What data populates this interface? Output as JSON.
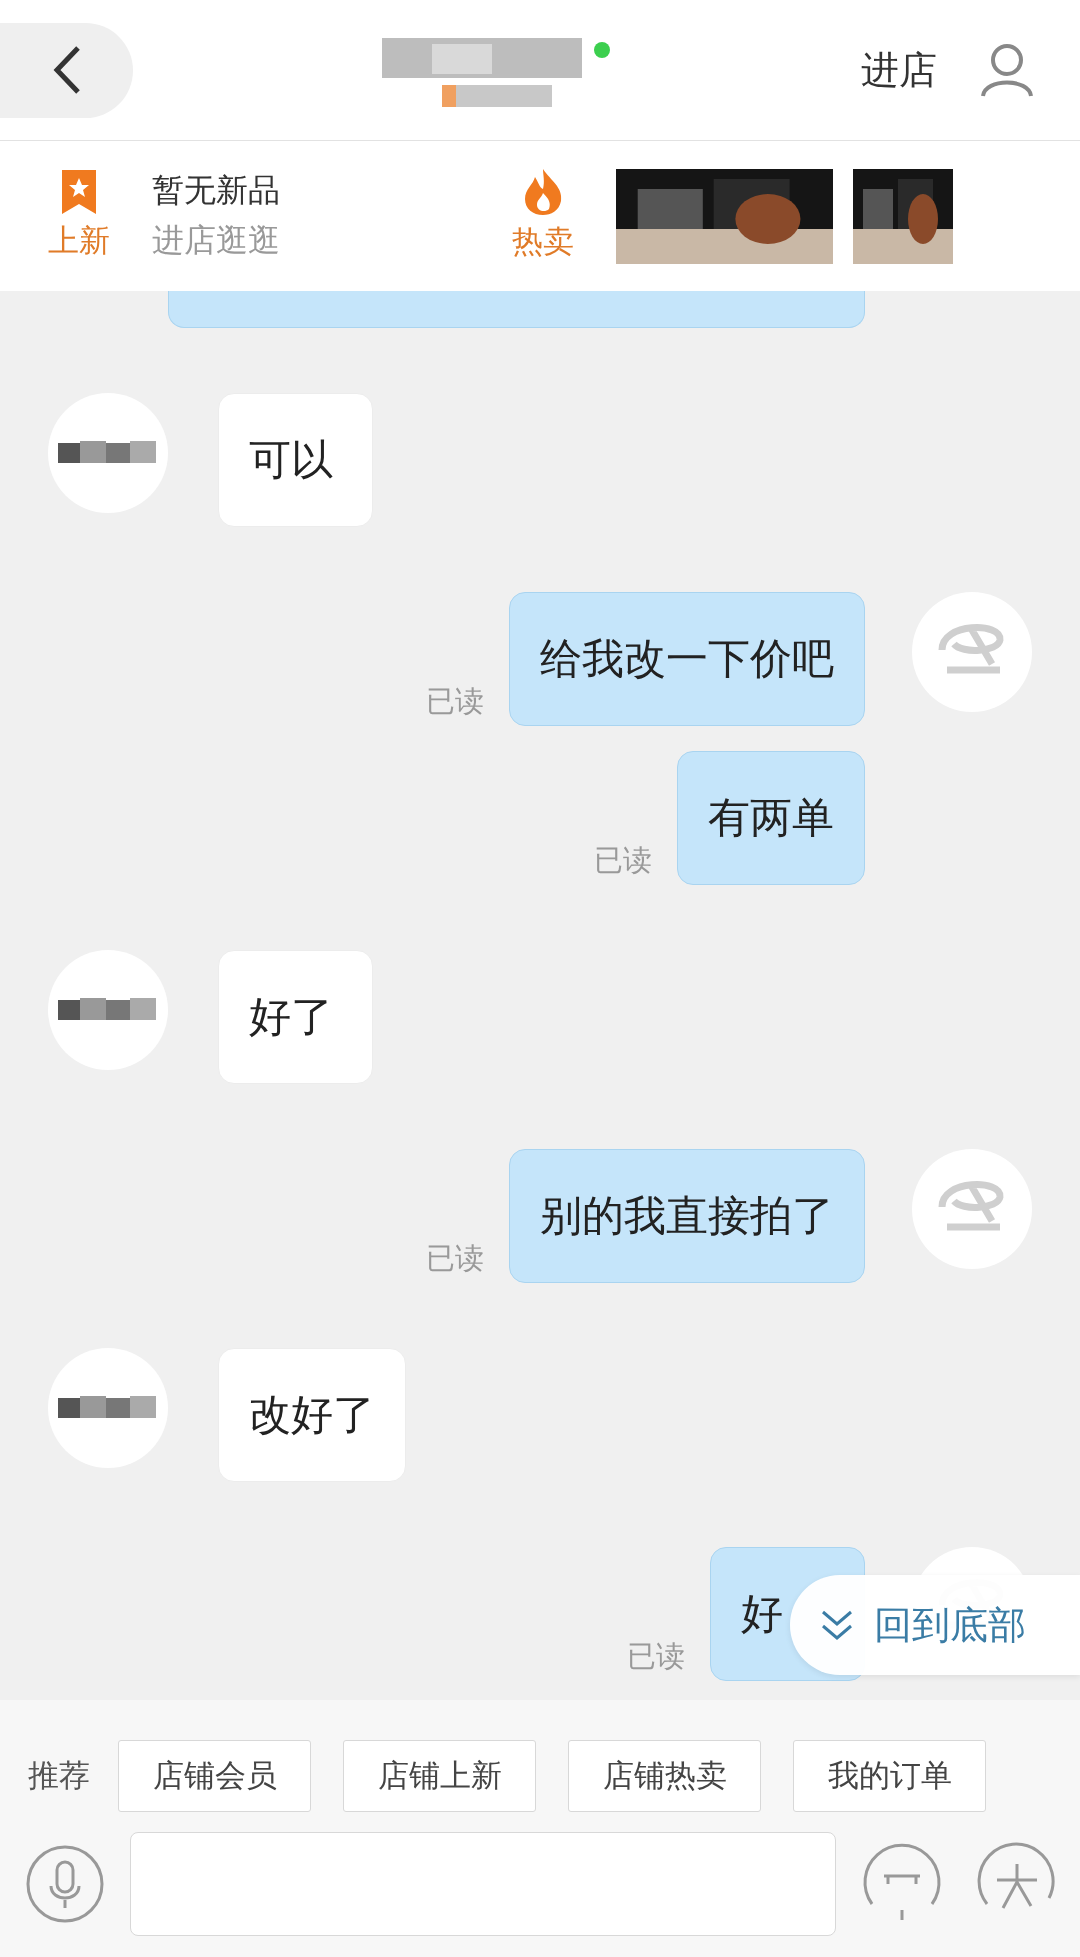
{
  "header": {
    "action": "进店"
  },
  "promo": {
    "new_label": "上新",
    "title": "暂无新品",
    "subtitle": "进店逛逛",
    "hot_label": "热卖"
  },
  "messages": [
    {
      "kind": "incoming",
      "text": "可以"
    },
    {
      "kind": "outgoing",
      "text": "给我改一下价吧",
      "status": "已读"
    },
    {
      "kind": "outgoing",
      "text": "有两单",
      "status": "已读"
    },
    {
      "kind": "incoming",
      "text": "好了"
    },
    {
      "kind": "outgoing",
      "text": "别的我直接拍了",
      "status": "已读"
    },
    {
      "kind": "incoming",
      "text": "改好了"
    },
    {
      "kind": "outgoing",
      "text": "好",
      "status": "已读"
    }
  ],
  "jump_button": "回到底部",
  "quick_replies": {
    "label": "推荐",
    "items": [
      "店铺会员",
      "店铺上新",
      "店铺热卖",
      "我的订单"
    ]
  }
}
